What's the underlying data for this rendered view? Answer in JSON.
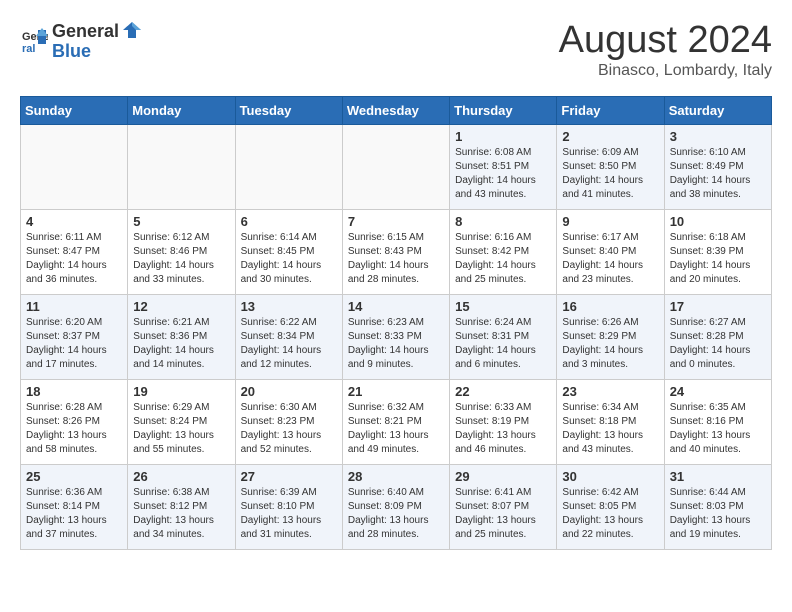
{
  "header": {
    "logo_general": "General",
    "logo_blue": "Blue",
    "month_title": "August 2024",
    "location": "Binasco, Lombardy, Italy"
  },
  "days_of_week": [
    "Sunday",
    "Monday",
    "Tuesday",
    "Wednesday",
    "Thursday",
    "Friday",
    "Saturday"
  ],
  "weeks": [
    [
      {
        "day": "",
        "info": ""
      },
      {
        "day": "",
        "info": ""
      },
      {
        "day": "",
        "info": ""
      },
      {
        "day": "",
        "info": ""
      },
      {
        "day": "1",
        "info": "Sunrise: 6:08 AM\nSunset: 8:51 PM\nDaylight: 14 hours\nand 43 minutes."
      },
      {
        "day": "2",
        "info": "Sunrise: 6:09 AM\nSunset: 8:50 PM\nDaylight: 14 hours\nand 41 minutes."
      },
      {
        "day": "3",
        "info": "Sunrise: 6:10 AM\nSunset: 8:49 PM\nDaylight: 14 hours\nand 38 minutes."
      }
    ],
    [
      {
        "day": "4",
        "info": "Sunrise: 6:11 AM\nSunset: 8:47 PM\nDaylight: 14 hours\nand 36 minutes."
      },
      {
        "day": "5",
        "info": "Sunrise: 6:12 AM\nSunset: 8:46 PM\nDaylight: 14 hours\nand 33 minutes."
      },
      {
        "day": "6",
        "info": "Sunrise: 6:14 AM\nSunset: 8:45 PM\nDaylight: 14 hours\nand 30 minutes."
      },
      {
        "day": "7",
        "info": "Sunrise: 6:15 AM\nSunset: 8:43 PM\nDaylight: 14 hours\nand 28 minutes."
      },
      {
        "day": "8",
        "info": "Sunrise: 6:16 AM\nSunset: 8:42 PM\nDaylight: 14 hours\nand 25 minutes."
      },
      {
        "day": "9",
        "info": "Sunrise: 6:17 AM\nSunset: 8:40 PM\nDaylight: 14 hours\nand 23 minutes."
      },
      {
        "day": "10",
        "info": "Sunrise: 6:18 AM\nSunset: 8:39 PM\nDaylight: 14 hours\nand 20 minutes."
      }
    ],
    [
      {
        "day": "11",
        "info": "Sunrise: 6:20 AM\nSunset: 8:37 PM\nDaylight: 14 hours\nand 17 minutes."
      },
      {
        "day": "12",
        "info": "Sunrise: 6:21 AM\nSunset: 8:36 PM\nDaylight: 14 hours\nand 14 minutes."
      },
      {
        "day": "13",
        "info": "Sunrise: 6:22 AM\nSunset: 8:34 PM\nDaylight: 14 hours\nand 12 minutes."
      },
      {
        "day": "14",
        "info": "Sunrise: 6:23 AM\nSunset: 8:33 PM\nDaylight: 14 hours\nand 9 minutes."
      },
      {
        "day": "15",
        "info": "Sunrise: 6:24 AM\nSunset: 8:31 PM\nDaylight: 14 hours\nand 6 minutes."
      },
      {
        "day": "16",
        "info": "Sunrise: 6:26 AM\nSunset: 8:29 PM\nDaylight: 14 hours\nand 3 minutes."
      },
      {
        "day": "17",
        "info": "Sunrise: 6:27 AM\nSunset: 8:28 PM\nDaylight: 14 hours\nand 0 minutes."
      }
    ],
    [
      {
        "day": "18",
        "info": "Sunrise: 6:28 AM\nSunset: 8:26 PM\nDaylight: 13 hours\nand 58 minutes."
      },
      {
        "day": "19",
        "info": "Sunrise: 6:29 AM\nSunset: 8:24 PM\nDaylight: 13 hours\nand 55 minutes."
      },
      {
        "day": "20",
        "info": "Sunrise: 6:30 AM\nSunset: 8:23 PM\nDaylight: 13 hours\nand 52 minutes."
      },
      {
        "day": "21",
        "info": "Sunrise: 6:32 AM\nSunset: 8:21 PM\nDaylight: 13 hours\nand 49 minutes."
      },
      {
        "day": "22",
        "info": "Sunrise: 6:33 AM\nSunset: 8:19 PM\nDaylight: 13 hours\nand 46 minutes."
      },
      {
        "day": "23",
        "info": "Sunrise: 6:34 AM\nSunset: 8:18 PM\nDaylight: 13 hours\nand 43 minutes."
      },
      {
        "day": "24",
        "info": "Sunrise: 6:35 AM\nSunset: 8:16 PM\nDaylight: 13 hours\nand 40 minutes."
      }
    ],
    [
      {
        "day": "25",
        "info": "Sunrise: 6:36 AM\nSunset: 8:14 PM\nDaylight: 13 hours\nand 37 minutes."
      },
      {
        "day": "26",
        "info": "Sunrise: 6:38 AM\nSunset: 8:12 PM\nDaylight: 13 hours\nand 34 minutes."
      },
      {
        "day": "27",
        "info": "Sunrise: 6:39 AM\nSunset: 8:10 PM\nDaylight: 13 hours\nand 31 minutes."
      },
      {
        "day": "28",
        "info": "Sunrise: 6:40 AM\nSunset: 8:09 PM\nDaylight: 13 hours\nand 28 minutes."
      },
      {
        "day": "29",
        "info": "Sunrise: 6:41 AM\nSunset: 8:07 PM\nDaylight: 13 hours\nand 25 minutes."
      },
      {
        "day": "30",
        "info": "Sunrise: 6:42 AM\nSunset: 8:05 PM\nDaylight: 13 hours\nand 22 minutes."
      },
      {
        "day": "31",
        "info": "Sunrise: 6:44 AM\nSunset: 8:03 PM\nDaylight: 13 hours\nand 19 minutes."
      }
    ]
  ]
}
